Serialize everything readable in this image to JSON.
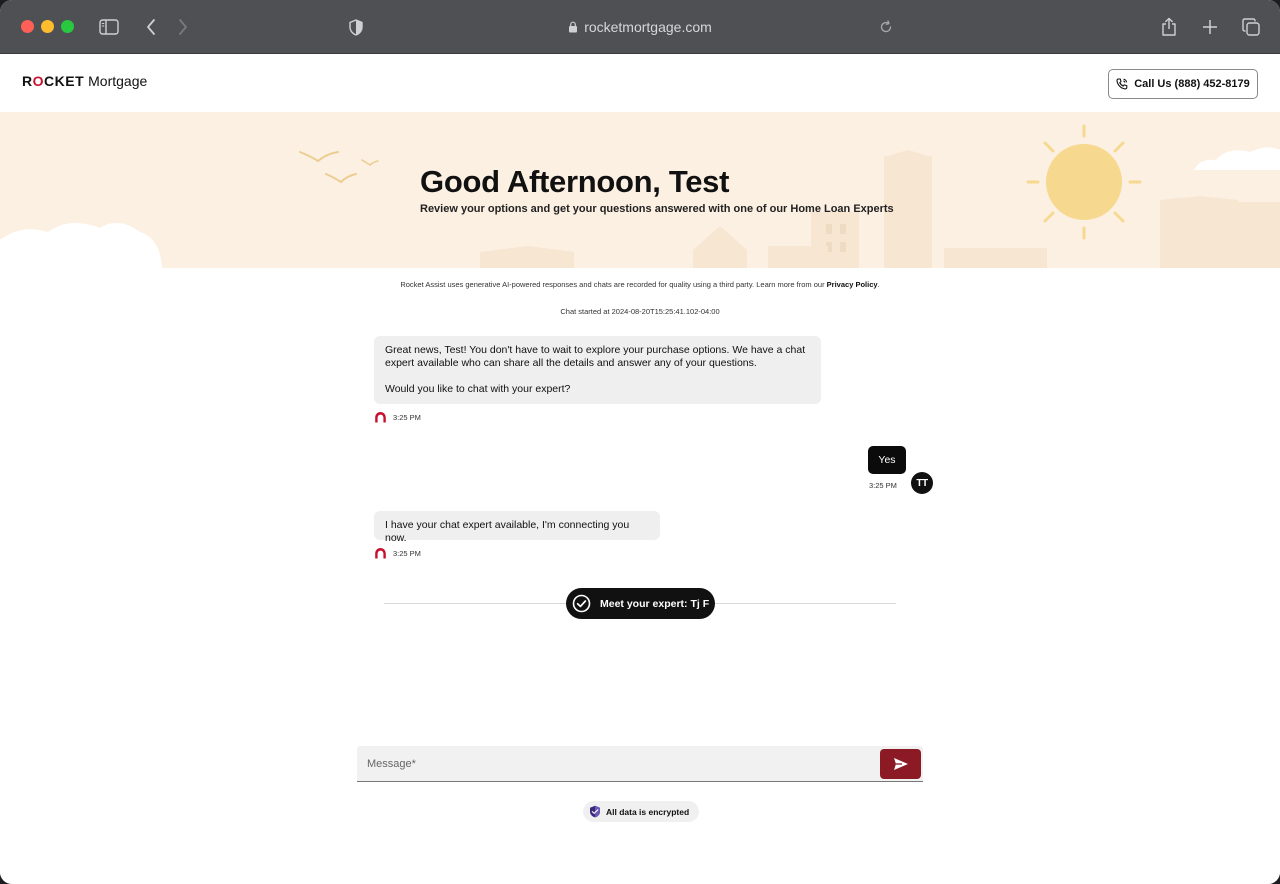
{
  "browser": {
    "url": "rocketmortgage.com"
  },
  "header": {
    "logo_rocket": "ROCKET",
    "logo_mortgage": "Mortgage",
    "call_label": "Call Us (888) 452-8179"
  },
  "hero": {
    "title": "Good Afternoon, Test",
    "subtitle": "Review your options and get your questions answered with one of our Home Loan Experts"
  },
  "chat": {
    "disclaimer_text": "Rocket Assist uses generative AI-powered responses and chats are recorded for quality using a third party. Learn more from our",
    "disclaimer_link": "Privacy Policy",
    "disclaimer_end": ".",
    "started_text": "Chat started at 2024-08-20T15:25:41.102-04:00",
    "messages": [
      {
        "sender": "bot",
        "line1": "Great news, Test! You don't have to wait to explore your purchase options. We have a chat",
        "line2": "expert available who can share all the details and answer any of your questions.",
        "line3": "Would you like to chat with your expert?",
        "time": "3:25 PM"
      },
      {
        "sender": "user",
        "text": "Yes",
        "time": "3:25 PM",
        "initials": "TT"
      },
      {
        "sender": "bot",
        "text": "I have your chat expert available, I'm connecting you now.",
        "time": "3:25 PM"
      }
    ],
    "expert_label": "Meet your expert: Tj F"
  },
  "composer": {
    "placeholder": "Message*",
    "value": ""
  },
  "footer": {
    "encrypted_label": "All data is encrypted"
  },
  "colors": {
    "brand_red": "#c8102e",
    "send_button": "#8c1a24",
    "hero_bg": "#fcf0e3",
    "sun": "#f6d98e"
  }
}
